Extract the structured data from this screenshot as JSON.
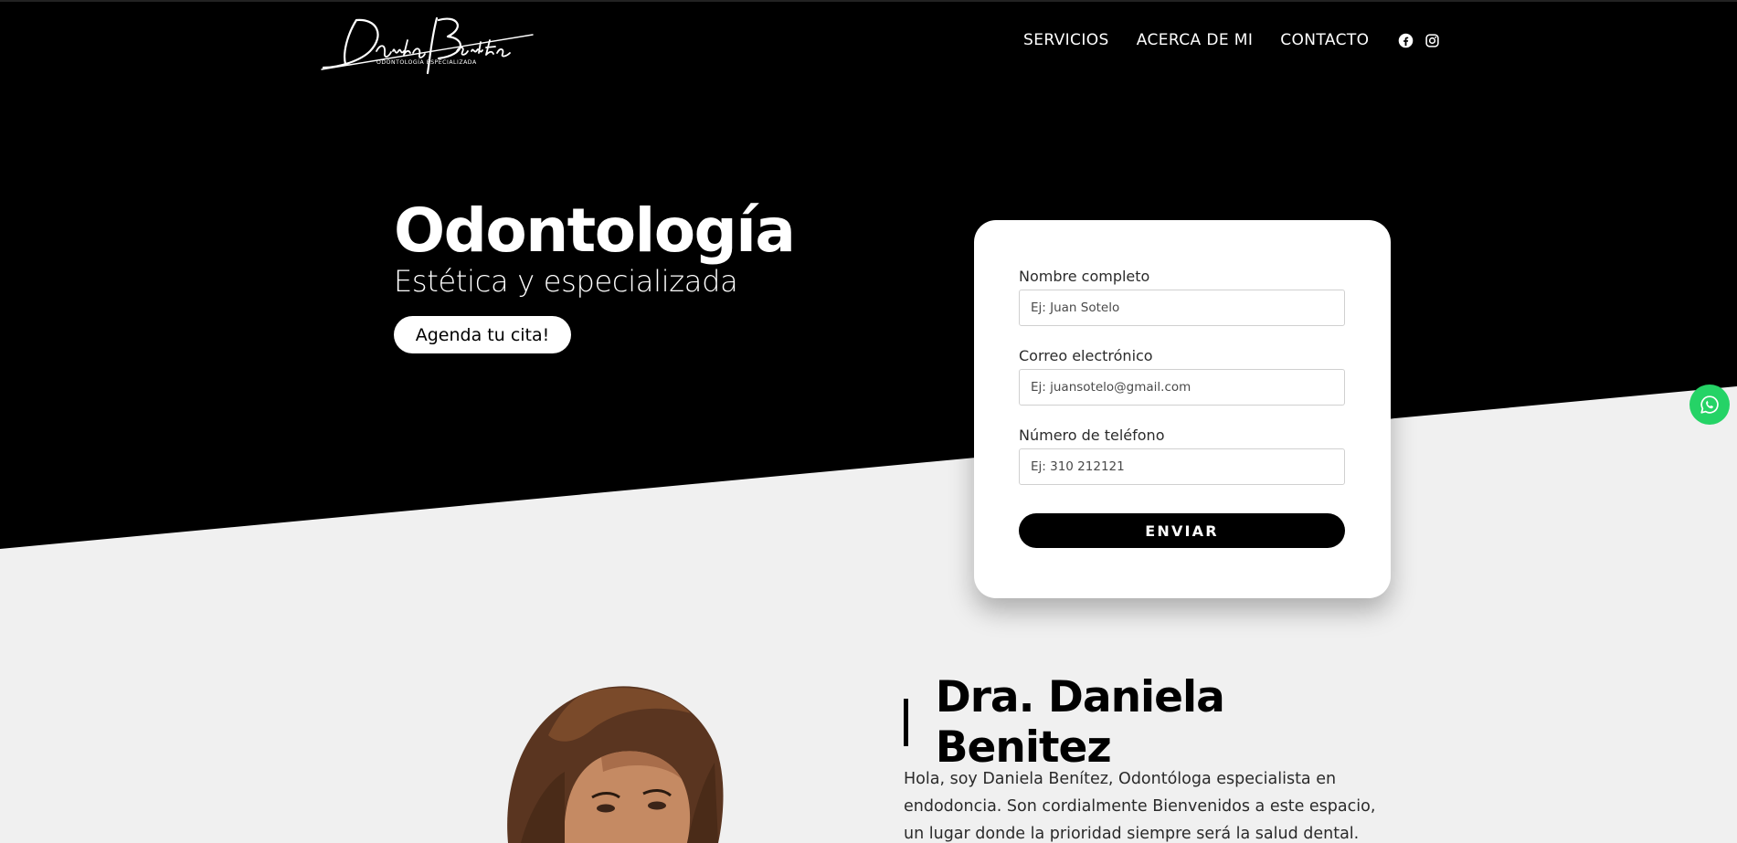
{
  "brand": {
    "logo_script": "Daniela Benitez",
    "logo_tagline": "ODONTOLOGÍA ESPECIALIZADA"
  },
  "nav": {
    "items": [
      "SERVICIOS",
      "ACERCA DE MI",
      "CONTACTO"
    ],
    "social": [
      "facebook-icon",
      "instagram-icon"
    ]
  },
  "hero": {
    "title": "Odontología",
    "subtitle": "Estética y especializada",
    "cta_label": "Agenda tu cita!"
  },
  "form": {
    "name_label": "Nombre completo",
    "name_placeholder": "Ej: Juan Sotelo",
    "email_label": "Correo electrónico",
    "email_placeholder": "Ej: juansotelo@gmail.com",
    "phone_label": "Número de teléfono",
    "phone_placeholder": "Ej: 310 212121",
    "submit_label": "ENVIAR"
  },
  "floating": {
    "icon": "whatsapp-icon",
    "color": "#25d366"
  },
  "about": {
    "name": "Dra. Daniela Benitez",
    "text": "Hola, soy Daniela Benítez, Odontóloga especialista en endodoncia. Son cordialmente Bienvenidos a este espacio, un lugar donde la prioridad siempre será la salud dental. Aquí trabajaremos siempre"
  },
  "colors": {
    "hero_bg": "#000000",
    "page_bg": "#f0f0f0",
    "accent": "#000000"
  }
}
